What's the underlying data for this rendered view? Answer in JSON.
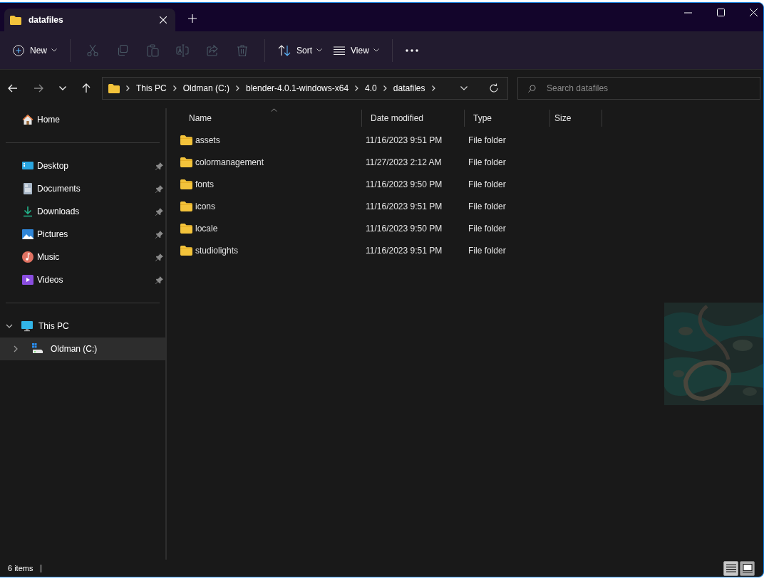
{
  "tab": {
    "title": "datafiles",
    "selected": true
  },
  "toolbar": {
    "new": {
      "label": "New"
    },
    "actions": [
      {
        "disabled": true
      },
      {
        "disabled": true
      },
      {
        "disabled": true
      },
      {
        "disabled": true
      },
      {
        "disabled": true
      },
      {
        "disabled": true
      }
    ],
    "sort": {
      "label": "Sort"
    },
    "view": {
      "label": "View"
    }
  },
  "navigation": {
    "back": {
      "disabled": false
    },
    "forward": {
      "disabled": true
    },
    "up": {
      "disabled": false
    }
  },
  "address": {
    "breadcrumbs": [
      "This PC",
      "Oldman (C:)",
      "blender-4.0.1-windows-x64",
      "4.0",
      "datafiles"
    ]
  },
  "search": {
    "placeholder": "Search datafiles"
  },
  "sidebar": {
    "home": {
      "label": "Home"
    },
    "quick_access": [
      {
        "label": "Desktop",
        "pinned": true
      },
      {
        "label": "Documents",
        "pinned": true
      },
      {
        "label": "Downloads",
        "pinned": true
      },
      {
        "label": "Pictures",
        "pinned": true
      },
      {
        "label": "Music",
        "pinned": true
      },
      {
        "label": "Videos",
        "pinned": true
      }
    ],
    "tree": [
      {
        "label": "This PC",
        "expanded": true,
        "selected": false,
        "children": [
          {
            "label": "Oldman (C:)",
            "expanded": false,
            "highlighted": true
          }
        ]
      }
    ]
  },
  "table": {
    "columns": [
      {
        "label": "Name",
        "sorted": true
      },
      {
        "label": "Date modified",
        "sorted": false
      },
      {
        "label": "Type",
        "sorted": false
      },
      {
        "label": "Size",
        "sorted": false
      }
    ],
    "rows": [
      {
        "name": "assets",
        "date": "11/16/2023 9:51 PM",
        "type": "File folder",
        "selected": false
      },
      {
        "name": "colormanagement",
        "date": "11/27/2023 2:12 AM",
        "type": "File folder",
        "selected": false
      },
      {
        "name": "fonts",
        "date": "11/16/2023 9:50 PM",
        "type": "File folder",
        "selected": false
      },
      {
        "name": "icons",
        "date": "11/16/2023 9:51 PM",
        "type": "File folder",
        "selected": false
      },
      {
        "name": "locale",
        "date": "11/16/2023 9:50 PM",
        "type": "File folder",
        "selected": false
      },
      {
        "name": "studiolights",
        "date": "11/16/2023 9:51 PM",
        "type": "File folder",
        "selected": false
      }
    ]
  },
  "status_bar": {
    "count": "6 items",
    "views": [
      {
        "selected": true
      },
      {
        "selected": false
      }
    ]
  }
}
